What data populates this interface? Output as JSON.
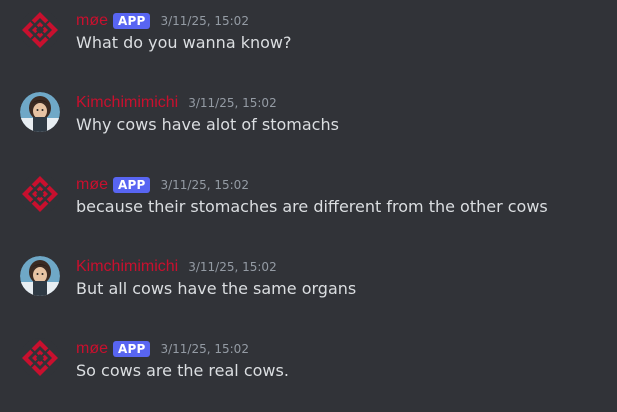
{
  "messages": [
    {
      "author": "møe",
      "badge": "APP",
      "timestamp": "3/11/25, 15:02",
      "text": "What do you wanna know?",
      "avatar_icon": "red-diamond-logo-icon"
    },
    {
      "author": "Kimchimimichi",
      "badge": "",
      "timestamp": "3/11/25, 15:02",
      "text": "Why cows have alot of stomachs",
      "avatar_icon": "anime-character-avatar"
    },
    {
      "author": "møe",
      "badge": "APP",
      "timestamp": "3/11/25, 15:02",
      "text": "because their stomaches are different from the other cows",
      "avatar_icon": "red-diamond-logo-icon"
    },
    {
      "author": "Kimchimimichi",
      "badge": "",
      "timestamp": "3/11/25, 15:02",
      "text": "But all cows have the same organs",
      "avatar_icon": "anime-character-avatar"
    },
    {
      "author": "møe",
      "badge": "APP",
      "timestamp": "3/11/25, 15:02",
      "text": "So cows are the real cows.",
      "avatar_icon": "red-diamond-logo-icon"
    }
  ],
  "colors": {
    "background": "#313338",
    "username": "#c8102e",
    "badge": "#5865f2",
    "timestamp": "#949ba4",
    "message_text": "#dbdee1"
  }
}
